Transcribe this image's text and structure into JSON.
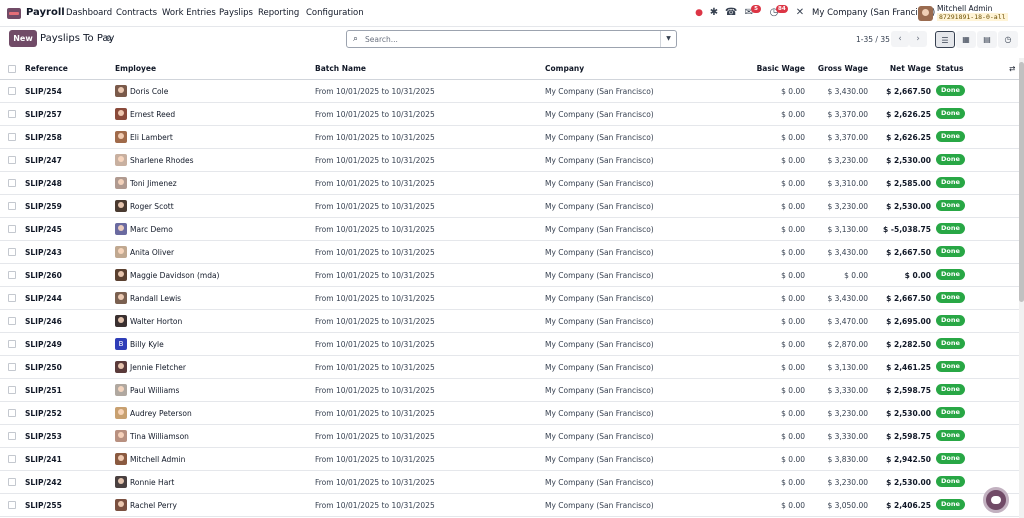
{
  "navbar": {
    "app_name": "Payroll",
    "menu": [
      "Dashboard",
      "Contracts",
      "Work Entries",
      "Payslips",
      "Reporting",
      "Configuration"
    ],
    "messages_badge": "5",
    "activities_badge": "84",
    "company": "My Company (San Francisco)",
    "user_name": "Mitchell Admin",
    "database": "87291891-18-0-all"
  },
  "control": {
    "new_label": "New",
    "title": "Payslips To Pay",
    "search_placeholder": "Search...",
    "pager": "1-35 / 35"
  },
  "table": {
    "headers": {
      "reference": "Reference",
      "employee": "Employee",
      "batch": "Batch Name",
      "company": "Company",
      "basic": "Basic Wage",
      "gross": "Gross Wage",
      "net": "Net Wage",
      "status": "Status"
    },
    "rows": [
      {
        "ref": "SLIP/254",
        "employee": "Doris Cole",
        "batch": "From 10/01/2025 to 10/31/2025",
        "company": "My Company (San Francisco)",
        "basic": "$ 0.00",
        "gross": "$ 3,430.00",
        "net": "$ 2,667.50",
        "status": "Done",
        "avatar": "#7a5a4a"
      },
      {
        "ref": "SLIP/257",
        "employee": "Ernest Reed",
        "batch": "From 10/01/2025 to 10/31/2025",
        "company": "My Company (San Francisco)",
        "basic": "$ 0.00",
        "gross": "$ 3,370.00",
        "net": "$ 2,626.25",
        "status": "Done",
        "avatar": "#8a4a3a"
      },
      {
        "ref": "SLIP/258",
        "employee": "Eli Lambert",
        "batch": "From 10/01/2025 to 10/31/2025",
        "company": "My Company (San Francisco)",
        "basic": "$ 0.00",
        "gross": "$ 3,370.00",
        "net": "$ 2,626.25",
        "status": "Done",
        "avatar": "#a06a4a"
      },
      {
        "ref": "SLIP/247",
        "employee": "Sharlene Rhodes",
        "batch": "From 10/01/2025 to 10/31/2025",
        "company": "My Company (San Francisco)",
        "basic": "$ 0.00",
        "gross": "$ 3,230.00",
        "net": "$ 2,530.00",
        "status": "Done",
        "avatar": "#c8b0a0"
      },
      {
        "ref": "SLIP/248",
        "employee": "Toni Jimenez",
        "batch": "From 10/01/2025 to 10/31/2025",
        "company": "My Company (San Francisco)",
        "basic": "$ 0.00",
        "gross": "$ 3,310.00",
        "net": "$ 2,585.00",
        "status": "Done",
        "avatar": "#b09a90"
      },
      {
        "ref": "SLIP/259",
        "employee": "Roger Scott",
        "batch": "From 10/01/2025 to 10/31/2025",
        "company": "My Company (San Francisco)",
        "basic": "$ 0.00",
        "gross": "$ 3,230.00",
        "net": "$ 2,530.00",
        "status": "Done",
        "avatar": "#4a3a30"
      },
      {
        "ref": "SLIP/245",
        "employee": "Marc Demo",
        "batch": "From 10/01/2025 to 10/31/2025",
        "company": "My Company (San Francisco)",
        "basic": "$ 0.00",
        "gross": "$ 3,130.00",
        "net": "$ -5,038.75",
        "status": "Done",
        "avatar": "#6a6aa0"
      },
      {
        "ref": "SLIP/243",
        "employee": "Anita Oliver",
        "batch": "From 10/01/2025 to 10/31/2025",
        "company": "My Company (San Francisco)",
        "basic": "$ 0.00",
        "gross": "$ 3,430.00",
        "net": "$ 2,667.50",
        "status": "Done",
        "avatar": "#c0a890"
      },
      {
        "ref": "SLIP/260",
        "employee": "Maggie Davidson (mda)",
        "batch": "From 10/01/2025 to 10/31/2025",
        "company": "My Company (San Francisco)",
        "basic": "$ 0.00",
        "gross": "$ 0.00",
        "net": "$ 0.00",
        "status": "Done",
        "avatar": "#5a4030"
      },
      {
        "ref": "SLIP/244",
        "employee": "Randall Lewis",
        "batch": "From 10/01/2025 to 10/31/2025",
        "company": "My Company (San Francisco)",
        "basic": "$ 0.00",
        "gross": "$ 3,430.00",
        "net": "$ 2,667.50",
        "status": "Done",
        "avatar": "#7a6050"
      },
      {
        "ref": "SLIP/246",
        "employee": "Walter Horton",
        "batch": "From 10/01/2025 to 10/31/2025",
        "company": "My Company (San Francisco)",
        "basic": "$ 0.00",
        "gross": "$ 3,470.00",
        "net": "$ 2,695.00",
        "status": "Done",
        "avatar": "#3a3030"
      },
      {
        "ref": "SLIP/249",
        "employee": "Billy Kyle",
        "batch": "From 10/01/2025 to 10/31/2025",
        "company": "My Company (San Francisco)",
        "basic": "$ 0.00",
        "gross": "$ 2,870.00",
        "net": "$ 2,282.50",
        "status": "Done",
        "avatar": "#2f3eb8",
        "letter": "B"
      },
      {
        "ref": "SLIP/250",
        "employee": "Jennie Fletcher",
        "batch": "From 10/01/2025 to 10/31/2025",
        "company": "My Company (San Francisco)",
        "basic": "$ 0.00",
        "gross": "$ 3,130.00",
        "net": "$ 2,461.25",
        "status": "Done",
        "avatar": "#5a3a3a"
      },
      {
        "ref": "SLIP/251",
        "employee": "Paul Williams",
        "batch": "From 10/01/2025 to 10/31/2025",
        "company": "My Company (San Francisco)",
        "basic": "$ 0.00",
        "gross": "$ 3,330.00",
        "net": "$ 2,598.75",
        "status": "Done",
        "avatar": "#b0a8a0"
      },
      {
        "ref": "SLIP/252",
        "employee": "Audrey Peterson",
        "batch": "From 10/01/2025 to 10/31/2025",
        "company": "My Company (San Francisco)",
        "basic": "$ 0.00",
        "gross": "$ 3,230.00",
        "net": "$ 2,530.00",
        "status": "Done",
        "avatar": "#c8a070"
      },
      {
        "ref": "SLIP/253",
        "employee": "Tina Williamson",
        "batch": "From 10/01/2025 to 10/31/2025",
        "company": "My Company (San Francisco)",
        "basic": "$ 0.00",
        "gross": "$ 3,330.00",
        "net": "$ 2,598.75",
        "status": "Done",
        "avatar": "#b89080"
      },
      {
        "ref": "SLIP/241",
        "employee": "Mitchell Admin",
        "batch": "From 10/01/2025 to 10/31/2025",
        "company": "My Company (San Francisco)",
        "basic": "$ 0.00",
        "gross": "$ 3,830.00",
        "net": "$ 2,942.50",
        "status": "Done",
        "avatar": "#8a5a40"
      },
      {
        "ref": "SLIP/242",
        "employee": "Ronnie Hart",
        "batch": "From 10/01/2025 to 10/31/2025",
        "company": "My Company (San Francisco)",
        "basic": "$ 0.00",
        "gross": "$ 3,230.00",
        "net": "$ 2,530.00",
        "status": "Done",
        "avatar": "#4a4040"
      },
      {
        "ref": "SLIP/255",
        "employee": "Rachel Perry",
        "batch": "From 10/01/2025 to 10/31/2025",
        "company": "My Company (San Francisco)",
        "basic": "$ 0.00",
        "gross": "$ 3,050.00",
        "net": "$ 2,406.25",
        "status": "Done",
        "avatar": "#7a5040"
      }
    ]
  }
}
